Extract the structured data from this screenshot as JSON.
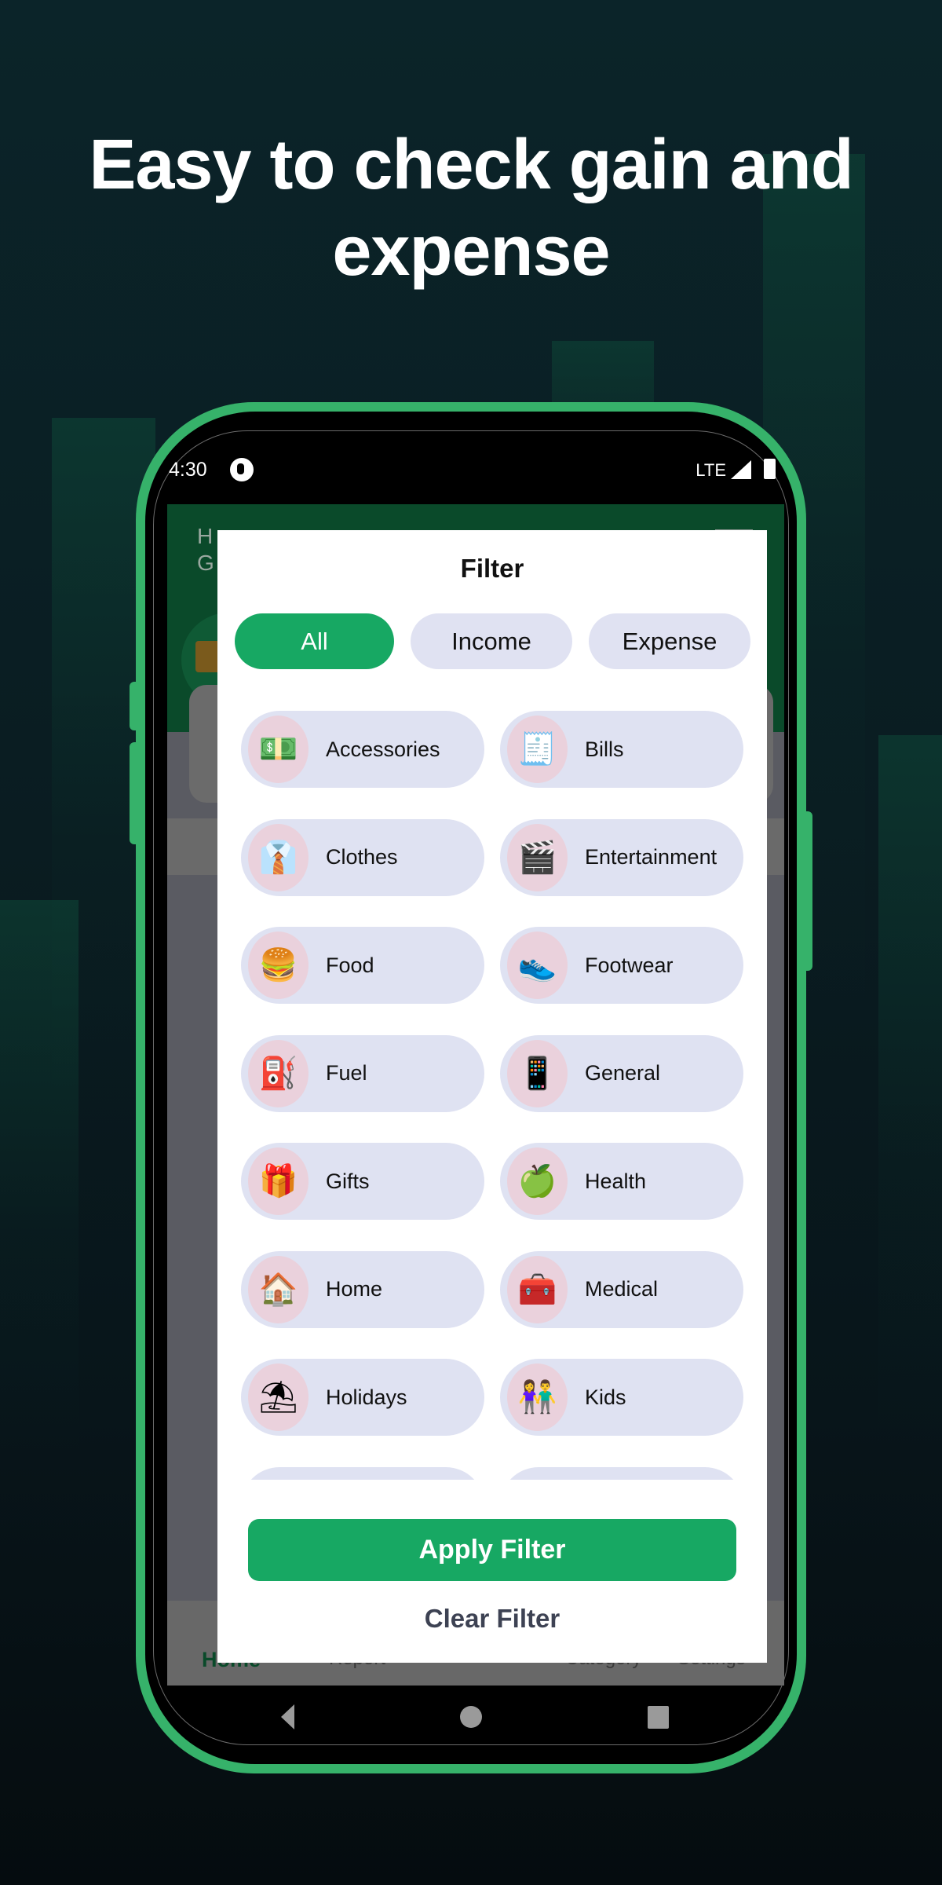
{
  "headline": {
    "line1": "Easy to check gain and",
    "line2": "expense"
  },
  "status_bar": {
    "time": "4:30",
    "network": "LTE",
    "icons": [
      "app-notification-icon",
      "signal-icon",
      "battery-icon"
    ]
  },
  "background_app": {
    "greeting_line1": "H",
    "greeting_line2": "G",
    "bottom_nav": [
      {
        "label": "Home",
        "active": true
      },
      {
        "label": "Report",
        "active": false
      },
      {
        "label": "Category",
        "active": false
      },
      {
        "label": "Settings",
        "active": false
      }
    ]
  },
  "dialog": {
    "title": "Filter",
    "segments": [
      {
        "label": "All",
        "selected": true
      },
      {
        "label": "Income",
        "selected": false
      },
      {
        "label": "Expense",
        "selected": false
      }
    ],
    "categories": [
      {
        "label": "Accessories",
        "icon": "money-box-icon",
        "glyph": "💵"
      },
      {
        "label": "Bills",
        "icon": "bill-receipt-icon",
        "glyph": "🧾"
      },
      {
        "label": "Clothes",
        "icon": "shirt-icon",
        "glyph": "👔"
      },
      {
        "label": "Entertainment",
        "icon": "clapper-phone-icon",
        "glyph": "🎬"
      },
      {
        "label": "Food",
        "icon": "burger-drink-icon",
        "glyph": "🍔"
      },
      {
        "label": "Footwear",
        "icon": "sneaker-icon",
        "glyph": "👟"
      },
      {
        "label": "Fuel",
        "icon": "fuel-nozzle-icon",
        "glyph": "⛽"
      },
      {
        "label": "General",
        "icon": "phone-document-icon",
        "glyph": "📱"
      },
      {
        "label": "Gifts",
        "icon": "gift-box-icon",
        "glyph": "🎁"
      },
      {
        "label": "Health",
        "icon": "health-apple-dumbbell-icon",
        "glyph": "🍏"
      },
      {
        "label": "Home",
        "icon": "house-icon",
        "glyph": "🏠"
      },
      {
        "label": "Medical",
        "icon": "first-aid-kit-icon",
        "glyph": "🧰"
      },
      {
        "label": "Holidays",
        "icon": "beach-umbrella-icon",
        "glyph": "⛱"
      },
      {
        "label": "Kids",
        "icon": "kids-icon",
        "glyph": "👫"
      },
      {
        "label": "",
        "icon": "",
        "glyph": ""
      },
      {
        "label": "",
        "icon": "",
        "glyph": ""
      }
    ],
    "apply_label": "Apply Filter",
    "clear_label": "Clear Filter"
  },
  "colors": {
    "accent_green": "#17a863",
    "phone_frame": "#36b26a",
    "chip_bg": "#dfe2f2",
    "icon_circle_bg": "#ead1dc",
    "header_green": "#0a4a2a"
  }
}
